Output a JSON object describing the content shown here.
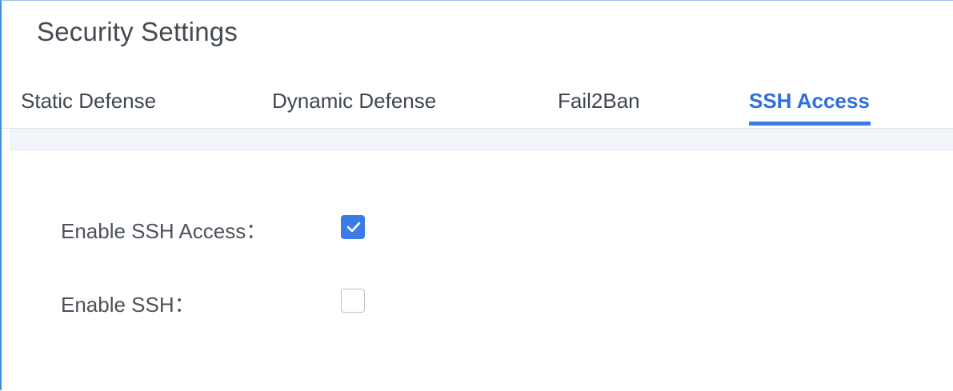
{
  "page": {
    "title": "Security Settings"
  },
  "tabs": [
    {
      "label": "Static Defense",
      "active": false
    },
    {
      "label": "Dynamic Defense",
      "active": false
    },
    {
      "label": "Fail2Ban",
      "active": false
    },
    {
      "label": "SSH Access",
      "active": true
    }
  ],
  "form": {
    "enable_ssh_access": {
      "label": "Enable SSH Access：",
      "checked": true
    },
    "enable_ssh": {
      "label": "Enable SSH：",
      "checked": false
    }
  },
  "colors": {
    "accent": "#3a7be8",
    "active_tab_text": "#2f6fdb",
    "text": "#4c525a",
    "divider_strip": "#f1f4f8"
  },
  "icons": {
    "checked_mark": "checkmark-icon"
  }
}
